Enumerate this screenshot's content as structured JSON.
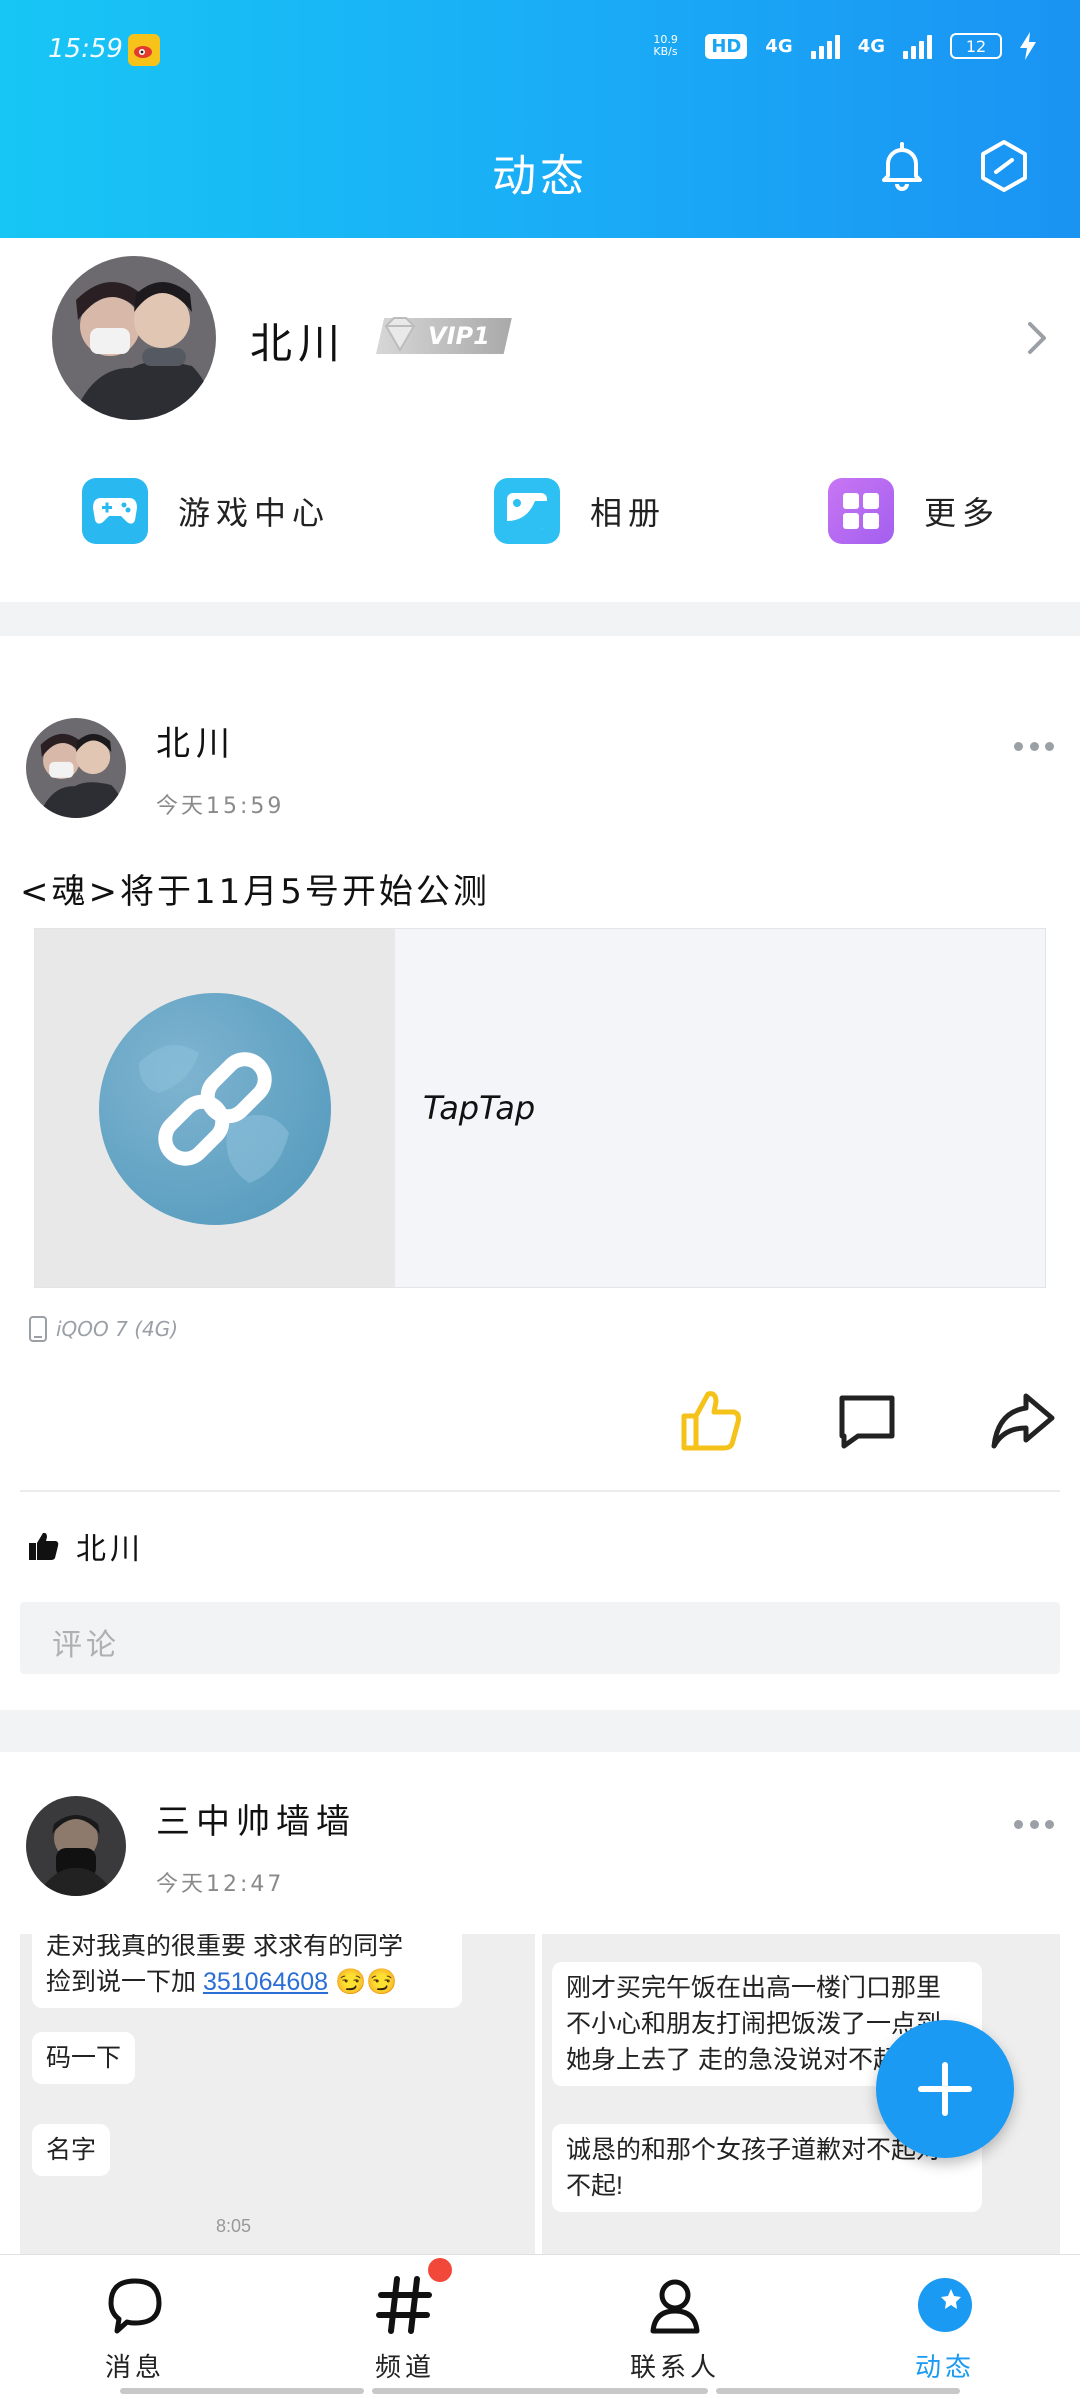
{
  "status_bar": {
    "time": "15:59",
    "net_speed": "10.9 KB/s",
    "hd": "HD",
    "net1": "4G",
    "net2": "4G",
    "battery": "12"
  },
  "header": {
    "title": "动态",
    "bell_icon": "bell-icon",
    "settings_icon": "hexagon-icon"
  },
  "profile": {
    "name": "北川",
    "vip": "VIP1",
    "quick_links": [
      {
        "label": "游戏中心",
        "icon": "gamepad-icon",
        "color": "#29b8f0"
      },
      {
        "label": "相册",
        "icon": "album-icon",
        "color": "#2ec0f2"
      },
      {
        "label": "更多",
        "icon": "grid-icon",
        "color": "#b86cf0"
      }
    ]
  },
  "post1": {
    "author": "北川",
    "time": "今天15:59",
    "text": "<魂>将于11月5号开始公测",
    "link_title": "TapTap",
    "device": "iQOO 7 (4G)",
    "liked_by": "北川",
    "comment_placeholder": "评论"
  },
  "post2": {
    "author": "三中帅墙墙",
    "time": "今天12:47",
    "left_image": {
      "bubble1_line1": "走对我真的很重要 求求有的同学",
      "bubble1_line2_prefix": "捡到说一下加 ",
      "bubble1_link": "351064608",
      "bubble2": "码一下",
      "bubble3": "名字",
      "timestamp": "8:05"
    },
    "right_image": {
      "bubble1_line1": "刚才买完午饭在出高一楼门口那里",
      "bubble1_line2": "不小心和朋友打闹把饭泼了一点到",
      "bubble1_line3": "她身上去了 走的急没说对不起",
      "bubble2_line1": "诚恳的和那个女孩子道歉对不起对",
      "bubble2_line2": "不起!"
    }
  },
  "bottom_nav": [
    {
      "label": "消息",
      "icon": "message-bubble-icon"
    },
    {
      "label": "频道",
      "icon": "hashtag-icon"
    },
    {
      "label": "联系人",
      "icon": "contact-person-icon"
    },
    {
      "label": "动态",
      "icon": "star-dynamic-icon",
      "active": true
    }
  ],
  "colors": {
    "brand": "#1a9af2",
    "like": "#f5c21a",
    "nav_active": "#1a9af2"
  }
}
